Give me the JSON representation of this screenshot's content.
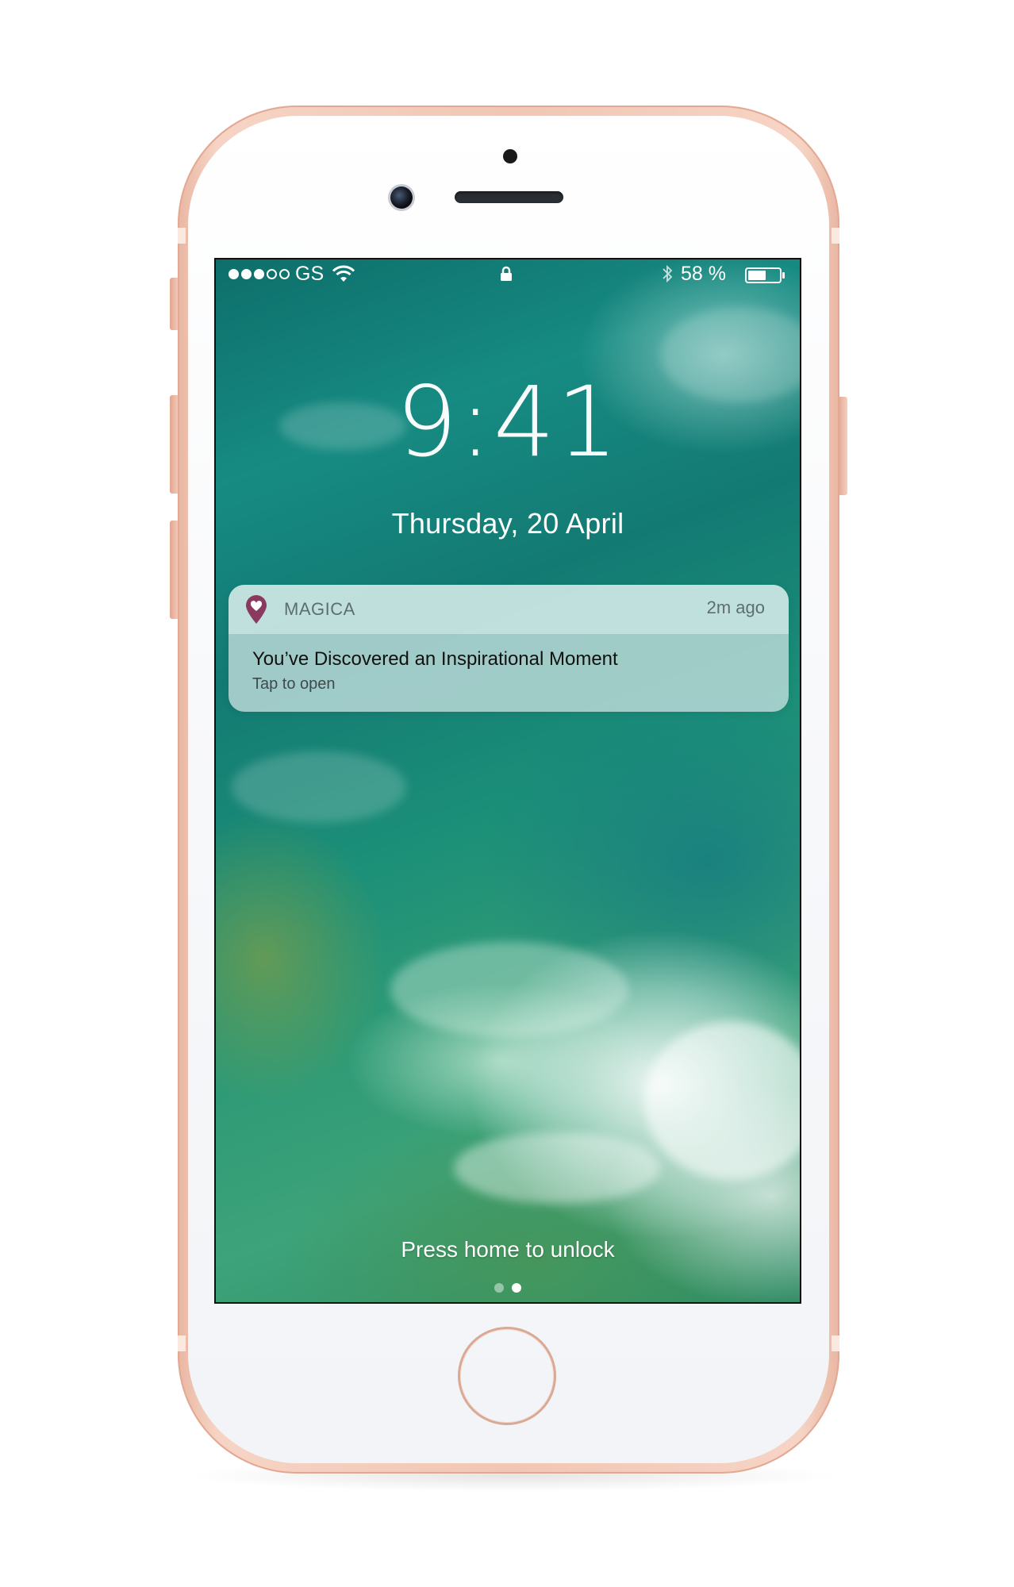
{
  "status_bar": {
    "signal": [
      "full",
      "full",
      "full",
      "empty",
      "empty"
    ],
    "carrier": "GS",
    "wifi_icon": "wifi-icon",
    "lock_icon": "lock-icon",
    "bluetooth_icon": "bluetooth-icon",
    "battery_percent": "58 %",
    "battery_level": 0.58,
    "battery_icon": "battery-icon"
  },
  "lock_screen": {
    "time": "9:41",
    "date": "Thursday, 20 April",
    "unlock_hint": "Press home to unlock",
    "pages": [
      "camera",
      "lock"
    ],
    "active_page": 1
  },
  "notification": {
    "app_icon": "map-pin-heart-icon",
    "app_name": "MAGICA",
    "time_ago": "2m ago",
    "title": "You’ve Discovered an Inspirational Moment",
    "subtitle": "Tap to open"
  },
  "colors": {
    "phone_frame": "#f2c6b3",
    "app_icon_accent": "#8a3a5e",
    "wallpaper_primary": "#168b82"
  }
}
